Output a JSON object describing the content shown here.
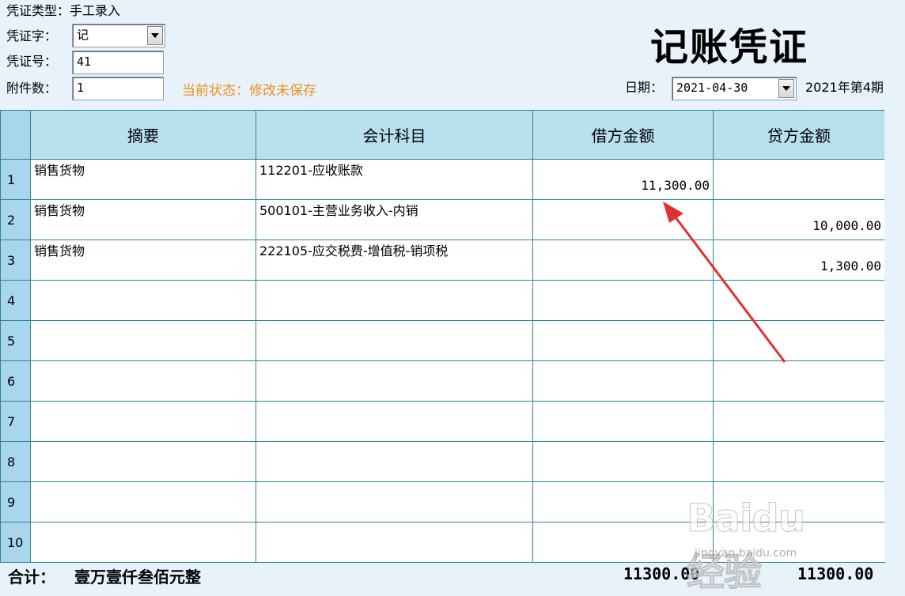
{
  "header": {
    "voucher_type_label": "凭证类型：",
    "voucher_type_value": "手工录入",
    "voucher_word_label": "凭证字：",
    "voucher_word_value": "记",
    "voucher_no_label": "凭证号：",
    "voucher_no_value": "41",
    "attachments_label": "附件数：",
    "attachments_value": "1",
    "status_text": "当前状态：修改未保存",
    "title": "记账凭证",
    "date_label": "日期：",
    "date_value": "2021-04-30",
    "period_text": "2021年第4期"
  },
  "table": {
    "columns": [
      "摘要",
      "会计科目",
      "借方金额",
      "贷方金额"
    ],
    "rows": [
      {
        "no": "1",
        "summary": "销售货物",
        "account": "112201-应收账款",
        "debit": "11,300.00",
        "credit": ""
      },
      {
        "no": "2",
        "summary": "销售货物",
        "account": "500101-主营业务收入-内销",
        "debit": "",
        "credit": "10,000.00"
      },
      {
        "no": "3",
        "summary": "销售货物",
        "account": "222105-应交税费-增值税-销项税",
        "debit": "",
        "credit": "1,300.00"
      },
      {
        "no": "4",
        "summary": "",
        "account": "",
        "debit": "",
        "credit": ""
      },
      {
        "no": "5",
        "summary": "",
        "account": "",
        "debit": "",
        "credit": ""
      },
      {
        "no": "6",
        "summary": "",
        "account": "",
        "debit": "",
        "credit": ""
      },
      {
        "no": "7",
        "summary": "",
        "account": "",
        "debit": "",
        "credit": ""
      },
      {
        "no": "8",
        "summary": "",
        "account": "",
        "debit": "",
        "credit": ""
      },
      {
        "no": "9",
        "summary": "",
        "account": "",
        "debit": "",
        "credit": ""
      },
      {
        "no": "10",
        "summary": "",
        "account": "",
        "debit": "",
        "credit": ""
      }
    ]
  },
  "footer": {
    "total_label": "合计：",
    "total_words": "壹万壹仟叁佰元整",
    "debit_total": "11300.00",
    "credit_total": "11300.00"
  },
  "watermark": {
    "brand": "Baidu经验",
    "url": "jingyan.baidu.com"
  },
  "colors": {
    "background": "#e7f2fb",
    "header_cell": "#b8e0ee",
    "row_number_cell": "#a8d6ec",
    "grid_line": "#2d8693",
    "status": "#f0901a",
    "annotation_arrow": "#e03030"
  },
  "icons": [
    "dropdown-arrow-icon",
    "annotation-arrow"
  ]
}
